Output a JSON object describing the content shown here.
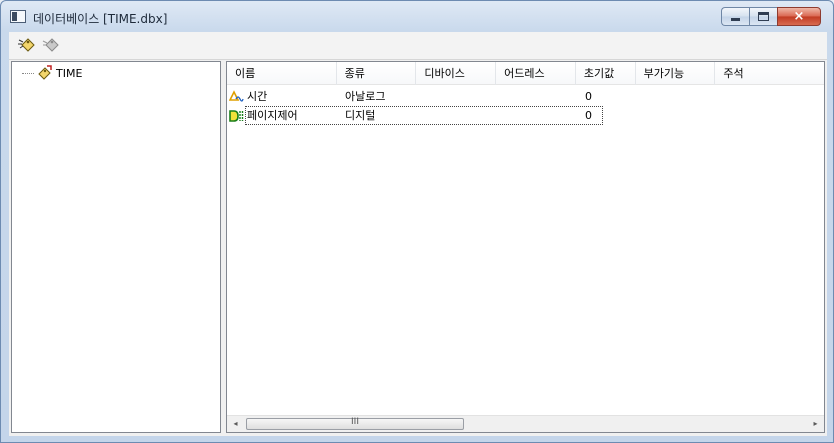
{
  "window": {
    "title": "데이터베이스 [TIME.dbx]",
    "icon": "window-app-icon",
    "controls": {
      "minimize": "minimize-icon",
      "maximize": "maximize-icon",
      "close": "×"
    }
  },
  "toolbar": {
    "buttons": [
      {
        "icon": "new-tag-icon",
        "enabled": true
      },
      {
        "icon": "tag-disabled-icon",
        "enabled": false
      }
    ]
  },
  "tree": {
    "root": {
      "label": "TIME",
      "icon": "database-tag-icon"
    }
  },
  "list": {
    "columns": [
      "이름",
      "종류",
      "디바이스",
      "어드레스",
      "초기값",
      "부가기능",
      "주석"
    ],
    "rows": [
      {
        "icon": "analog-tag-icon",
        "name": "시간",
        "type": "아날로그",
        "device": "",
        "address": "",
        "initial": "0",
        "extra": "",
        "comment": ""
      },
      {
        "icon": "digital-tag-icon",
        "name": "페이지제어",
        "type": "디지털",
        "device": "",
        "address": "",
        "initial": "0",
        "extra": "",
        "comment": "",
        "focused": true
      }
    ]
  },
  "scrollbar": {
    "left_arrow": "◂",
    "right_arrow": "▸",
    "grip": "III"
  },
  "colors": {
    "accent": "#6d8bb1",
    "close": "#c13a22",
    "analog_icon": "#e0a000",
    "digital_icon": "#1a7f1a"
  }
}
